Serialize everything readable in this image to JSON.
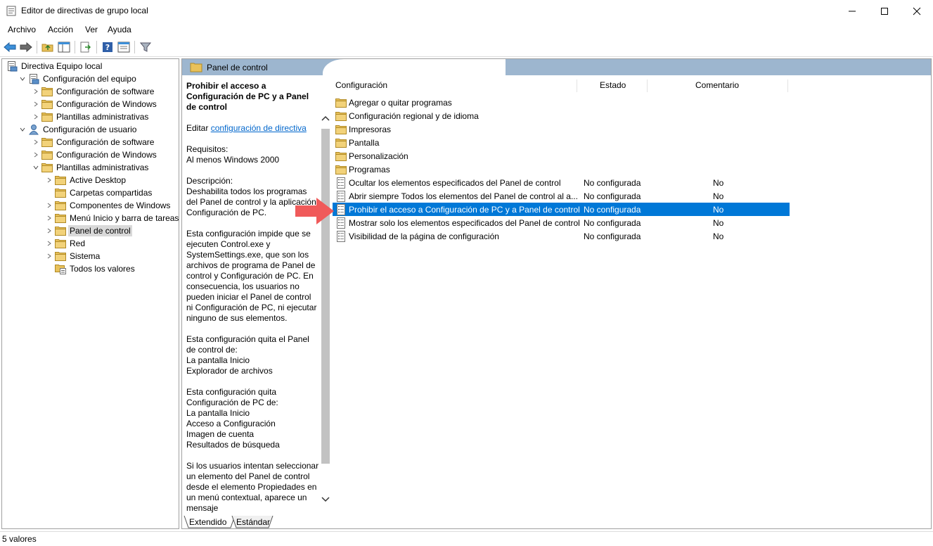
{
  "window": {
    "title": "Editor de directivas de grupo local"
  },
  "menu": [
    "Archivo",
    "Acción",
    "Ver",
    "Ayuda"
  ],
  "tree": [
    {
      "label": "Directiva Equipo local",
      "level": 0,
      "icon": "computer-policy-icon",
      "expander": "none"
    },
    {
      "label": "Configuración del equipo",
      "level": 1,
      "icon": "computer-icon",
      "expander": "expanded"
    },
    {
      "label": "Configuración de software",
      "level": 2,
      "icon": "folder-icon",
      "expander": "collapsed"
    },
    {
      "label": "Configuración de Windows",
      "level": 2,
      "icon": "folder-icon",
      "expander": "collapsed"
    },
    {
      "label": "Plantillas administrativas",
      "level": 2,
      "icon": "folder-icon",
      "expander": "collapsed"
    },
    {
      "label": "Configuración de usuario",
      "level": 1,
      "icon": "user-icon",
      "expander": "expanded"
    },
    {
      "label": "Configuración de software",
      "level": 2,
      "icon": "folder-icon",
      "expander": "collapsed"
    },
    {
      "label": "Configuración de Windows",
      "level": 2,
      "icon": "folder-icon",
      "expander": "collapsed"
    },
    {
      "label": "Plantillas administrativas",
      "level": 2,
      "icon": "folder-icon",
      "expander": "expanded"
    },
    {
      "label": "Active Desktop",
      "level": 3,
      "icon": "folder-icon",
      "expander": "collapsed"
    },
    {
      "label": "Carpetas compartidas",
      "level": 3,
      "icon": "folder-icon",
      "expander": "none"
    },
    {
      "label": "Componentes de Windows",
      "level": 3,
      "icon": "folder-icon",
      "expander": "collapsed"
    },
    {
      "label": "Menú Inicio y barra de tareas",
      "level": 3,
      "icon": "folder-icon",
      "expander": "collapsed"
    },
    {
      "label": "Panel de control",
      "level": 3,
      "icon": "folder-icon",
      "expander": "collapsed",
      "selected": true
    },
    {
      "label": "Red",
      "level": 3,
      "icon": "folder-icon",
      "expander": "collapsed"
    },
    {
      "label": "Sistema",
      "level": 3,
      "icon": "folder-icon",
      "expander": "collapsed"
    },
    {
      "label": "Todos los valores",
      "level": 3,
      "icon": "all-settings-icon",
      "expander": "none"
    }
  ],
  "right": {
    "header": "Panel de control",
    "description": {
      "title": "Prohibir el acceso a Configuración de PC y a Panel de control",
      "edit_prefix": "Editar",
      "edit_link": "configuración de directiva",
      "requirements_label": "Requisitos:",
      "requirements": "Al menos Windows 2000",
      "description_label": "Descripción:",
      "p1": "Deshabilita todos los programas del Panel de control y la aplicación Configuración de PC.",
      "p2": "Esta configuración impide que se ejecuten Control.exe y SystemSettings.exe, que son los archivos de programa de Panel de control y Configuración de PC. En consecuencia, los usuarios no pueden iniciar el Panel de control ni Configuración de PC, ni ejecutar ninguno de sus elementos.",
      "p3_lines": [
        "Esta configuración quita el Panel de control de:",
        "La pantalla Inicio",
        "Explorador de archivos"
      ],
      "p4_lines": [
        "Esta configuración quita Configuración de PC de:",
        "La pantalla Inicio",
        "Acceso a Configuración",
        "Imagen de cuenta",
        "Resultados de búsqueda"
      ],
      "p5": "Si los usuarios intentan seleccionar un elemento del Panel de control desde el elemento Propiedades en un menú contextual, aparece un mensaje"
    },
    "columns": {
      "name": "Configuración",
      "state": "Estado",
      "comment": "Comentario"
    },
    "rows": [
      {
        "name": "Agregar o quitar programas",
        "state": "",
        "comment": "",
        "icon": "folder-icon"
      },
      {
        "name": "Configuración regional y de idioma",
        "state": "",
        "comment": "",
        "icon": "folder-icon"
      },
      {
        "name": "Impresoras",
        "state": "",
        "comment": "",
        "icon": "folder-icon"
      },
      {
        "name": "Pantalla",
        "state": "",
        "comment": "",
        "icon": "folder-icon"
      },
      {
        "name": "Personalización",
        "state": "",
        "comment": "",
        "icon": "folder-icon"
      },
      {
        "name": "Programas",
        "state": "",
        "comment": "",
        "icon": "folder-icon"
      },
      {
        "name": "Ocultar los elementos especificados del Panel de control",
        "state": "No configurada",
        "comment": "No",
        "icon": "policy-setting-icon"
      },
      {
        "name": "Abrir siempre Todos los elementos del Panel de control al a...",
        "state": "No configurada",
        "comment": "No",
        "icon": "policy-setting-icon"
      },
      {
        "name": "Prohibir el acceso a Configuración de PC y a Panel de control",
        "state": "No configurada",
        "comment": "No",
        "icon": "policy-setting-icon",
        "selected": true
      },
      {
        "name": "Mostrar solo los elementos especificados del Panel de control",
        "state": "No configurada",
        "comment": "No",
        "icon": "policy-setting-icon"
      },
      {
        "name": "Visibilidad de la página de configuración",
        "state": "No configurada",
        "comment": "No",
        "icon": "policy-setting-icon"
      }
    ],
    "tabs": [
      "Extendido",
      "Estándar"
    ]
  },
  "status": "5 valores",
  "colors": {
    "header": "#9db6cf",
    "selection": "#0078d7",
    "arrow": "#f05a5a",
    "folder": "#e8c15a"
  }
}
